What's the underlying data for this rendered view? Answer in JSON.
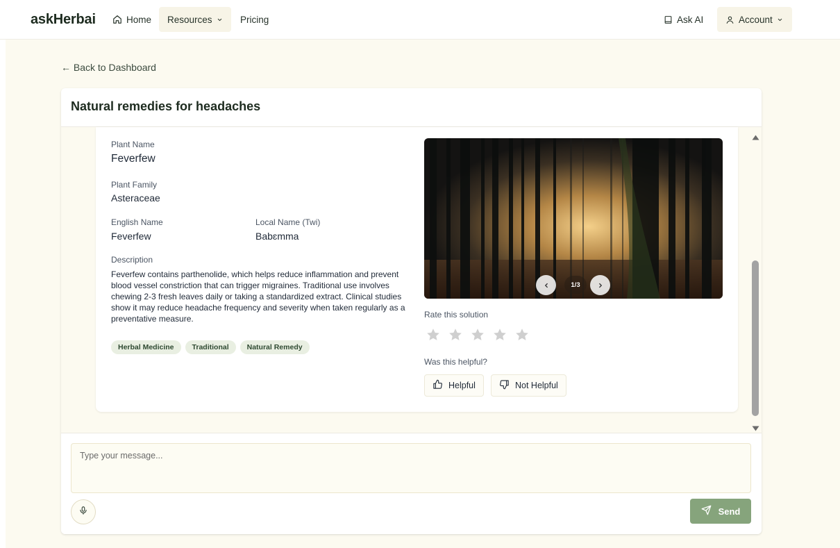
{
  "nav": {
    "logo": "askHerbai",
    "home": "Home",
    "resources": "Resources",
    "pricing": "Pricing",
    "ask_ai": "Ask AI",
    "account": "Account"
  },
  "back_link": "← Back to Dashboard",
  "conversation": {
    "title": "Natural remedies for headaches"
  },
  "plant": {
    "plant_name_label": "Plant Name",
    "plant_name": "Feverfew",
    "family_label": "Plant Family",
    "family": "Asteraceae",
    "english_name_label": "English Name",
    "english_name": "Feverfew",
    "local_name_label": "Local Name (Twi)",
    "local_name": "Babɛmma",
    "description_label": "Description",
    "description": "Feverfew contains parthenolide, which helps reduce inflammation and prevent blood vessel constriction that can trigger migraines. Traditional use involves chewing 2-3 fresh leaves daily or taking a standardized extract. Clinical studies show it may reduce headache frequency and severity when taken regularly as a preventative measure.",
    "tags": [
      "Herbal Medicine",
      "Traditional",
      "Natural Remedy"
    ]
  },
  "carousel": {
    "counter": "1/3"
  },
  "rating": {
    "label": "Rate this solution",
    "max_stars": 5,
    "selected": 0,
    "star_color": "#cfcfcf"
  },
  "feedback": {
    "label": "Was this helpful?",
    "helpful": "Helpful",
    "not_helpful": "Not Helpful"
  },
  "composer": {
    "placeholder": "Type your message...",
    "send_label": "Send"
  },
  "colors": {
    "accent": "#86a47c",
    "page_bg": "#fcfaf0",
    "tag_bg": "#e9efe2"
  }
}
